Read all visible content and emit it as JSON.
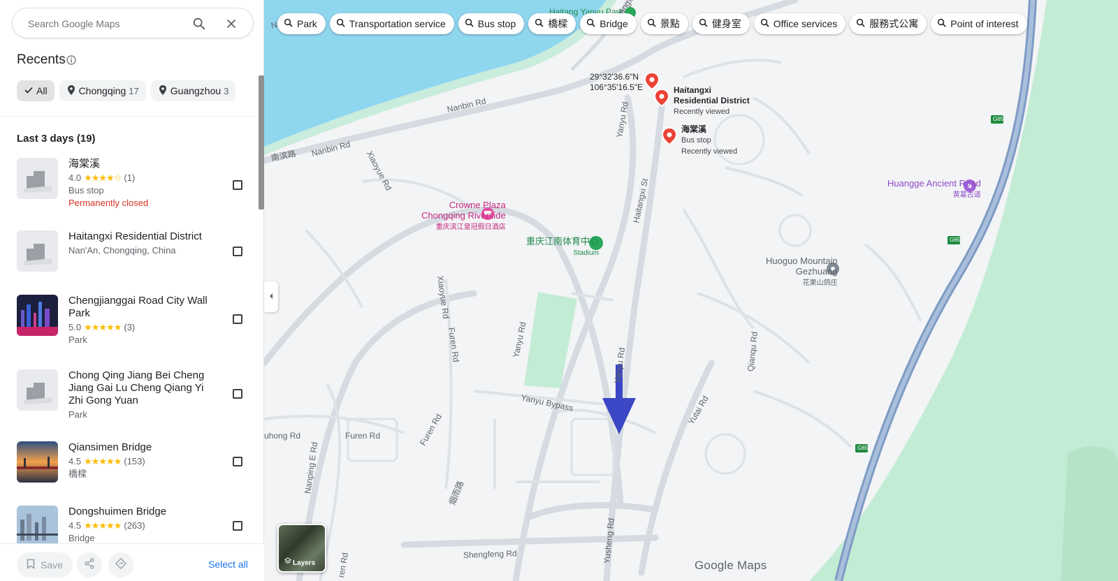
{
  "search": {
    "placeholder": "Search Google Maps"
  },
  "recents": {
    "title": "Recents",
    "chips": [
      {
        "label": "All",
        "count": ""
      },
      {
        "label": "Chongqing",
        "count": "17"
      },
      {
        "label": "Guangzhou",
        "count": "3"
      }
    ]
  },
  "section_title": "Last 3 days (19)",
  "items": [
    {
      "name": "海棠溪",
      "rating": "4.0",
      "stars": "★★★★☆",
      "reviews": "(1)",
      "category": "Bus stop",
      "status": "Permanently closed"
    },
    {
      "name": "Haitangxi Residential District",
      "address": "Nan'An, Chongqing, China"
    },
    {
      "name": "Chengjianggai Road City Wall Park",
      "rating": "5.0",
      "stars": "★★★★★",
      "reviews": "(3)",
      "category": "Park"
    },
    {
      "name": "Chong Qing Jiang Bei Cheng Jiang Gai Lu Cheng Qiang Yi Zhi Gong Yuan",
      "category": "Park"
    },
    {
      "name": "Qiansimen Bridge",
      "rating": "4.5",
      "stars": "★★★★★",
      "reviews": "(153)",
      "category": "橋樑"
    },
    {
      "name": "Dongshuimen Bridge",
      "rating": "4.5",
      "stars": "★★★★★",
      "reviews": "(263)",
      "category": "Bridge"
    }
  ],
  "bottom": {
    "save_label": "Save",
    "select_all": "Select all"
  },
  "filters": [
    "Park",
    "Transportation service",
    "Bus stop",
    "橋樑",
    "Bridge",
    "景點",
    "健身室",
    "Office services",
    "服務式公寓",
    "Point of interest"
  ],
  "map": {
    "pins": [
      {
        "label": "29°32'36.6\"N\n106°35'16.5\"E"
      },
      {
        "label": "Haitangxi\nResidential District",
        "sub": "Recently viewed"
      },
      {
        "label": "海棠溪",
        "sub": "Bus stop\nRecently viewed"
      }
    ],
    "pois": {
      "crowne_line1": "Crowne Plaza",
      "crowne_line2": "Chongqing Riverside",
      "crowne_cn": "重庆滨江皇冠假日酒店",
      "stadium_cn": "重庆江南体育中心",
      "stadium": "Stadium",
      "huangge": "Huangge Ancient Road",
      "huangge_cn": "黄葛古道",
      "huoguo_1": "Huoguo Mountain",
      "huoguo_2": "Gezhuang",
      "huoguo_cn": "花果山鸽庄",
      "yanyu_park": "Haitang Yanyu Park"
    },
    "roads": [
      "Nanbin Rd",
      "Nanbin Rd",
      "南滨路",
      "Nanbin Rd",
      "Haitangxi St",
      "Yanyu Rd",
      "Haitangxi St",
      "Xiaoyue Rd",
      "Xiaoyue Rd",
      "Furen Rd",
      "Yanyu Rd",
      "Yanyu Rd",
      "Yanyu Bypass",
      "Furen Rd",
      "Furen Rd",
      "Yutai Rd",
      "Qianqu Rd",
      "Nanping E Rd",
      "烟雨路",
      "Shengfeng Rd",
      "Yusheng Rd",
      "uhong Rd",
      "ren Rd"
    ],
    "highway": "G65",
    "layers_label": "Layers",
    "logo": "Google Maps"
  },
  "colors": {
    "water": "#8fd6ef",
    "park": "#c3ecd5",
    "road": "#d5dbe1",
    "highway": "#8aa4c8",
    "pin": "#ea4335",
    "accent": "#1a73e8",
    "arrow": "#3b47c4"
  }
}
